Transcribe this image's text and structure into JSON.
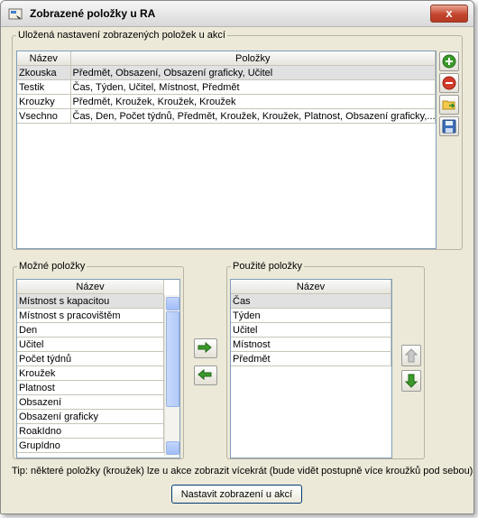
{
  "window": {
    "title": "Zobrazené položky u RA",
    "close_glyph": "x"
  },
  "saved": {
    "legend": "Uložená nastavení zobrazených položek u akcí",
    "columns": {
      "name": "Název",
      "items": "Položky"
    },
    "rows": [
      {
        "name": "Zkouska",
        "items": "Předmět, Obsazení, Obsazení graficky, Učitel"
      },
      {
        "name": "Testik",
        "items": "Čas, Týden, Učitel, Místnost, Předmět"
      },
      {
        "name": "Krouzky",
        "items": "Předmět, Kroužek, Kroužek, Kroužek"
      },
      {
        "name": "Vsechno",
        "items": "Čas, Den, Počet týdnů, Předmět, Kroužek, Kroužek, Platnost, Obsazení graficky,..."
      }
    ],
    "side_icons": [
      "add-icon",
      "remove-icon",
      "load-icon",
      "save-icon"
    ]
  },
  "possible": {
    "legend": "Možné položky",
    "column": "Název",
    "items": [
      "Místnost s kapacitou",
      "Místnost s pracovištěm",
      "Den",
      "Učitel",
      "Počet týdnů",
      "Kroužek",
      "Platnost",
      "Obsazení",
      "Obsazení graficky",
      "RoakIdno",
      "GrupIdno"
    ]
  },
  "used": {
    "legend": "Použité položky",
    "column": "Název",
    "items": [
      "Čas",
      "Týden",
      "Učitel",
      "Místnost",
      "Předmět"
    ]
  },
  "tip": "Tip: některé položky (kroužek) lze u akce zobrazit vícekrát (bude vidět postupně více kroužků pod sebou)",
  "apply_label": "Nastavit zobrazení u akcí",
  "colors": {
    "accent_green": "#3a9a2a",
    "accent_red": "#d23a2a",
    "selection": "#e1e1e1"
  }
}
